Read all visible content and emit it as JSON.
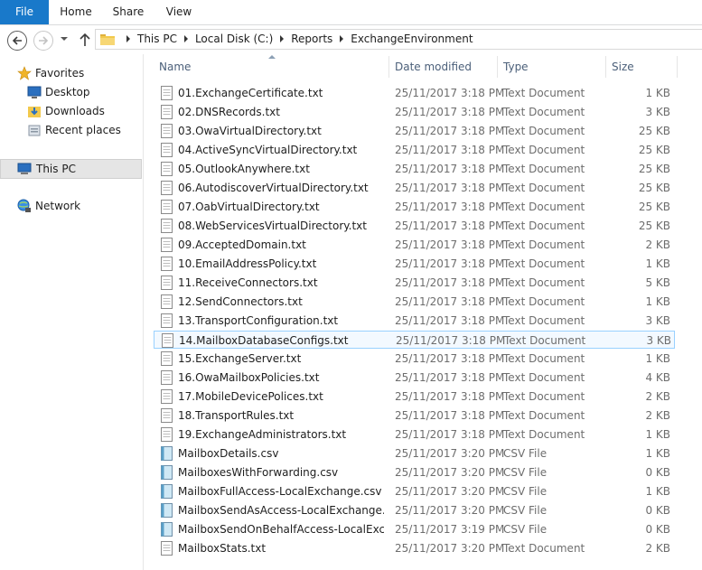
{
  "ribbon": {
    "file": "File",
    "home": "Home",
    "share": "Share",
    "view": "View"
  },
  "address": {
    "crumbs": [
      "This PC",
      "Local Disk (C:)",
      "Reports",
      "ExchangeEnvironment"
    ]
  },
  "nav": {
    "favorites": "Favorites",
    "desktop": "Desktop",
    "downloads": "Downloads",
    "recent": "Recent places",
    "thispc": "This PC",
    "network": "Network"
  },
  "columns": {
    "name": "Name",
    "date": "Date modified",
    "type": "Type",
    "size": "Size"
  },
  "files": [
    {
      "name": "01.ExchangeCertificate.txt",
      "date": "25/11/2017 3:18 PM",
      "type": "Text Document",
      "size": "1 KB",
      "kind": "txt"
    },
    {
      "name": "02.DNSRecords.txt",
      "date": "25/11/2017 3:18 PM",
      "type": "Text Document",
      "size": "3 KB",
      "kind": "txt"
    },
    {
      "name": "03.OwaVirtualDirectory.txt",
      "date": "25/11/2017 3:18 PM",
      "type": "Text Document",
      "size": "25 KB",
      "kind": "txt"
    },
    {
      "name": "04.ActiveSyncVirtualDirectory.txt",
      "date": "25/11/2017 3:18 PM",
      "type": "Text Document",
      "size": "25 KB",
      "kind": "txt"
    },
    {
      "name": "05.OutlookAnywhere.txt",
      "date": "25/11/2017 3:18 PM",
      "type": "Text Document",
      "size": "25 KB",
      "kind": "txt"
    },
    {
      "name": "06.AutodiscoverVirtualDirectory.txt",
      "date": "25/11/2017 3:18 PM",
      "type": "Text Document",
      "size": "25 KB",
      "kind": "txt"
    },
    {
      "name": "07.OabVirtualDirectory.txt",
      "date": "25/11/2017 3:18 PM",
      "type": "Text Document",
      "size": "25 KB",
      "kind": "txt"
    },
    {
      "name": "08.WebServicesVirtualDirectory.txt",
      "date": "25/11/2017 3:18 PM",
      "type": "Text Document",
      "size": "25 KB",
      "kind": "txt"
    },
    {
      "name": "09.AcceptedDomain.txt",
      "date": "25/11/2017 3:18 PM",
      "type": "Text Document",
      "size": "2 KB",
      "kind": "txt"
    },
    {
      "name": "10.EmailAddressPolicy.txt",
      "date": "25/11/2017 3:18 PM",
      "type": "Text Document",
      "size": "1 KB",
      "kind": "txt"
    },
    {
      "name": "11.ReceiveConnectors.txt",
      "date": "25/11/2017 3:18 PM",
      "type": "Text Document",
      "size": "5 KB",
      "kind": "txt"
    },
    {
      "name": "12.SendConnectors.txt",
      "date": "25/11/2017 3:18 PM",
      "type": "Text Document",
      "size": "1 KB",
      "kind": "txt"
    },
    {
      "name": "13.TransportConfiguration.txt",
      "date": "25/11/2017 3:18 PM",
      "type": "Text Document",
      "size": "3 KB",
      "kind": "txt"
    },
    {
      "name": "14.MailboxDatabaseConfigs.txt",
      "date": "25/11/2017 3:18 PM",
      "type": "Text Document",
      "size": "3 KB",
      "kind": "txt",
      "highlight": true
    },
    {
      "name": "15.ExchangeServer.txt",
      "date": "25/11/2017 3:18 PM",
      "type": "Text Document",
      "size": "1 KB",
      "kind": "txt"
    },
    {
      "name": "16.OwaMailboxPolicies.txt",
      "date": "25/11/2017 3:18 PM",
      "type": "Text Document",
      "size": "4 KB",
      "kind": "txt"
    },
    {
      "name": "17.MobileDevicePolices.txt",
      "date": "25/11/2017 3:18 PM",
      "type": "Text Document",
      "size": "2 KB",
      "kind": "txt"
    },
    {
      "name": "18.TransportRules.txt",
      "date": "25/11/2017 3:18 PM",
      "type": "Text Document",
      "size": "2 KB",
      "kind": "txt"
    },
    {
      "name": "19.ExchangeAdministrators.txt",
      "date": "25/11/2017 3:18 PM",
      "type": "Text Document",
      "size": "1 KB",
      "kind": "txt"
    },
    {
      "name": "MailboxDetails.csv",
      "date": "25/11/2017 3:20 PM",
      "type": "CSV File",
      "size": "1 KB",
      "kind": "csv"
    },
    {
      "name": "MailboxesWithForwarding.csv",
      "date": "25/11/2017 3:20 PM",
      "type": "CSV File",
      "size": "0 KB",
      "kind": "csv"
    },
    {
      "name": "MailboxFullAccess-LocalExchange.csv",
      "date": "25/11/2017 3:20 PM",
      "type": "CSV File",
      "size": "1 KB",
      "kind": "csv"
    },
    {
      "name": "MailboxSendAsAccess-LocalExchange.csv",
      "date": "25/11/2017 3:20 PM",
      "type": "CSV File",
      "size": "0 KB",
      "kind": "csv"
    },
    {
      "name": "MailboxSendOnBehalfAccess-LocalExcha...",
      "date": "25/11/2017 3:19 PM",
      "type": "CSV File",
      "size": "0 KB",
      "kind": "csv"
    },
    {
      "name": "MailboxStats.txt",
      "date": "25/11/2017 3:20 PM",
      "type": "Text Document",
      "size": "2 KB",
      "kind": "txt"
    }
  ],
  "icons": {
    "back": "back-arrow-icon",
    "forward": "forward-arrow-icon",
    "up": "up-arrow-icon",
    "folder": "folder-icon",
    "txt": "text-file-icon",
    "csv": "csv-file-icon"
  },
  "colors": {
    "file_tab": "#1979ca",
    "header_text": "#4c607a",
    "highlight_border": "#99d1ff"
  }
}
